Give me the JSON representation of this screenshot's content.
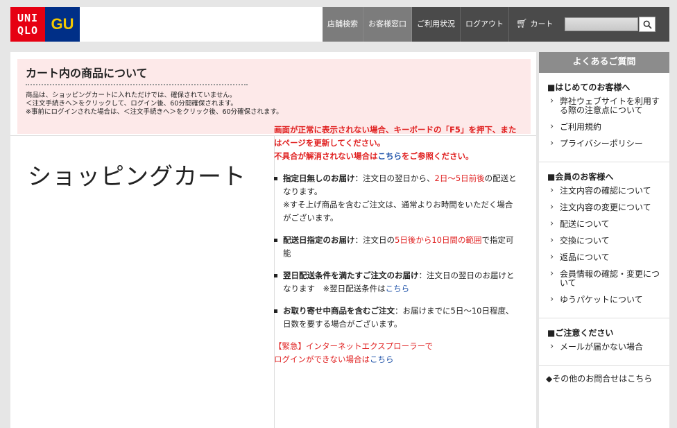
{
  "header": {
    "logo_uniqlo_top": "UNI",
    "logo_uniqlo_bottom": "QLO",
    "logo_gu": "GU",
    "nav": [
      "店舗検索",
      "お客様窓口",
      "ご利用状況",
      "ログアウト"
    ],
    "cart_label": "カート",
    "search_placeholder": "",
    "search_icon": "search-icon",
    "colors": {
      "uniqlo_red": "#e60012",
      "gu_blue": "#002f87",
      "gu_yellow": "#f4c800",
      "nav_light": "#7c7c7c",
      "nav_dark": "#4a4a4a"
    }
  },
  "notice": {
    "title": "カート内の商品について",
    "lines": [
      "商品は、ショッピングカートに入れただけでは、確保されていません。",
      "＜注文手続きへ＞をクリックして、ログイン後、60分間確保されます。",
      "※事前にログインされた場合は、＜注文手続きへ＞をクリック後、60分確保されます。"
    ]
  },
  "main": {
    "page_title": "ショッピングカート",
    "warning_1": "画面が正常に表示されない場合、キーボードの「F5」を押下、またはページを更新してください。",
    "warning_2_before": "不具合が解消されない場合は",
    "warning_2_link": "こちら",
    "warning_2_after": "をご参照ください。",
    "bullets": {
      "b1_label": "指定日無しのお届け",
      "b1_text1": "：注文日の翌日から、",
      "b1_red": "2日～5日前後",
      "b1_text2": "の配送となります。",
      "b1_note": "※すそ上げ商品を含むご注文は、通常よりお時間をいただく場合がございます。",
      "b2_label": "配送日指定のお届け",
      "b2_text1": "：注文日の",
      "b2_red": "5日後から10日間の範囲",
      "b2_text2": "で指定可能",
      "b3_label": "翌日配送条件を満たすご注文のお届け",
      "b3_text": "：注文日の翌日のお届けとなります　※翌日配送条件は",
      "b3_link": "こちら",
      "b4_label": "お取り寄せ中商品を含むご注文",
      "b4_text": "：お届けまでに5日～10日程度、日数を要する場合がございます。"
    },
    "emergency_line1": "【緊急】インターネットエクスプローラーで",
    "emergency_line2_before": "ログインができない場合は",
    "emergency_link": "こちら"
  },
  "sidebar": {
    "header": "よくあるご質問",
    "sections": [
      {
        "heading": "■はじめてのお客様へ",
        "items": [
          "弊社ウェブサイトを利用する際の注意点について",
          "ご利用規約",
          "プライバシーポリシー"
        ]
      },
      {
        "heading": "■会員のお客様へ",
        "items": [
          "注文内容の確認について",
          "注文内容の変更について",
          "配送について",
          "交換について",
          "返品について",
          "会員情報の確認・変更について",
          "ゆうパケットについて"
        ]
      },
      {
        "heading": "■ご注意ください",
        "items": [
          "メールが届かない場合"
        ]
      }
    ],
    "footer": "◆その他のお問合せはこちら"
  }
}
